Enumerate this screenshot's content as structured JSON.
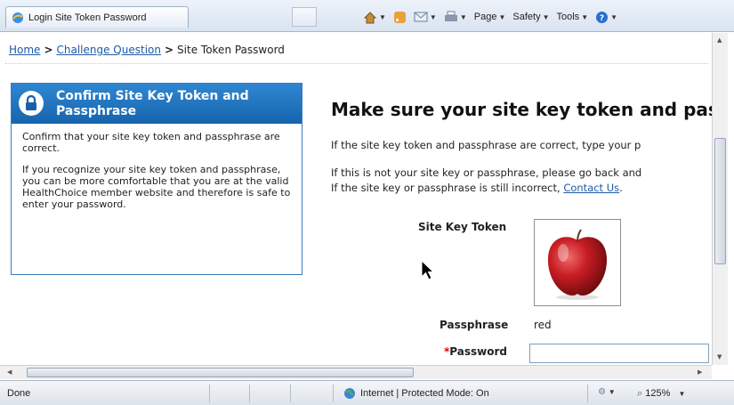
{
  "browser": {
    "tab_title": "Login Site Token Password",
    "commands": {
      "page": "Page",
      "safety": "Safety",
      "tools": "Tools"
    }
  },
  "breadcrumb": {
    "home": "Home",
    "challenge": "Challenge Question",
    "current": "Site Token Password",
    "separator": ">"
  },
  "infobox": {
    "title": "Confirm Site Key Token and Passphrase",
    "para1": "Confirm that your site key token and passphrase are correct.",
    "para2": "If you recognize your site key token and passphrase, you can be more comfortable that you are at the valid HealthChoice member website and therefore is safe to enter your password."
  },
  "main": {
    "heading": "Make sure your site key token and pass",
    "line1": "If the site key token and passphrase are correct, type your p",
    "line2": "If this is not your site key or passphrase, please go back and",
    "line3_prefix": "If the site key or passphrase is still incorrect,",
    "contact_link": "Contact Us",
    "line3_suffix": "."
  },
  "form": {
    "site_key_label": "Site Key Token",
    "site_key_image": "apple-icon",
    "passphrase_label": "Passphrase",
    "passphrase_value": "red",
    "password_required_mark": "*",
    "password_label": "Password",
    "password_value": ""
  },
  "statusbar": {
    "status": "Done",
    "zone": "Internet | Protected Mode: On",
    "zoom": "125%"
  },
  "colors": {
    "accent": "#1f6fbf",
    "link": "#1f5aa6",
    "required": "#dd0000"
  }
}
